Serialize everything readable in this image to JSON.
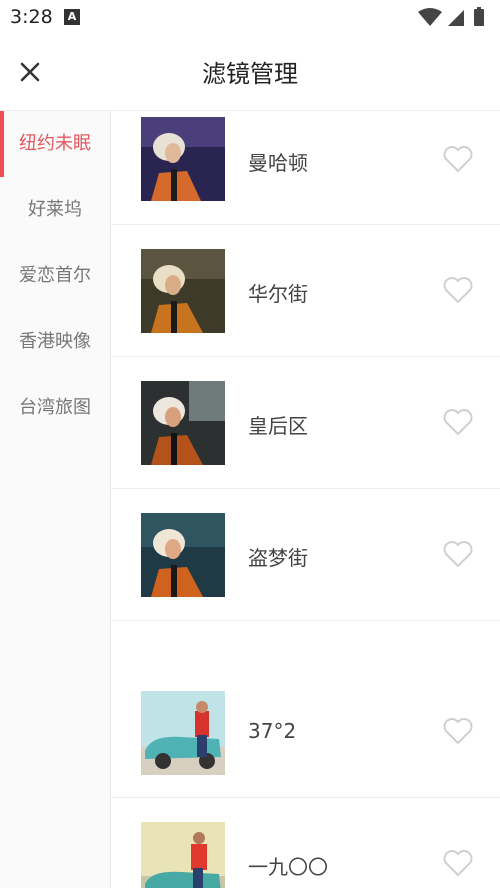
{
  "status": {
    "time": "3:28",
    "app_icon": "A"
  },
  "header": {
    "title": "滤镜管理",
    "close_icon": "close-icon"
  },
  "sidebar": {
    "items": [
      {
        "label": "纽约未眠",
        "active": true
      },
      {
        "label": "好莱坞",
        "active": false
      },
      {
        "label": "爱恋首尔",
        "active": false
      },
      {
        "label": "香港映像",
        "active": false
      },
      {
        "label": "台湾旅图",
        "active": false
      }
    ]
  },
  "filters": [
    {
      "label": "曼哈顿",
      "favorite": false
    },
    {
      "label": "华尔街",
      "favorite": false
    },
    {
      "label": "皇后区",
      "favorite": false
    },
    {
      "label": "盗梦街",
      "favorite": false
    },
    {
      "label": "37°2",
      "favorite": false
    },
    {
      "label": "一九〇〇",
      "favorite": false
    }
  ],
  "colors": {
    "accent": "#f04e56",
    "active_text": "#e5585f",
    "heart": "#cfcfcf"
  }
}
